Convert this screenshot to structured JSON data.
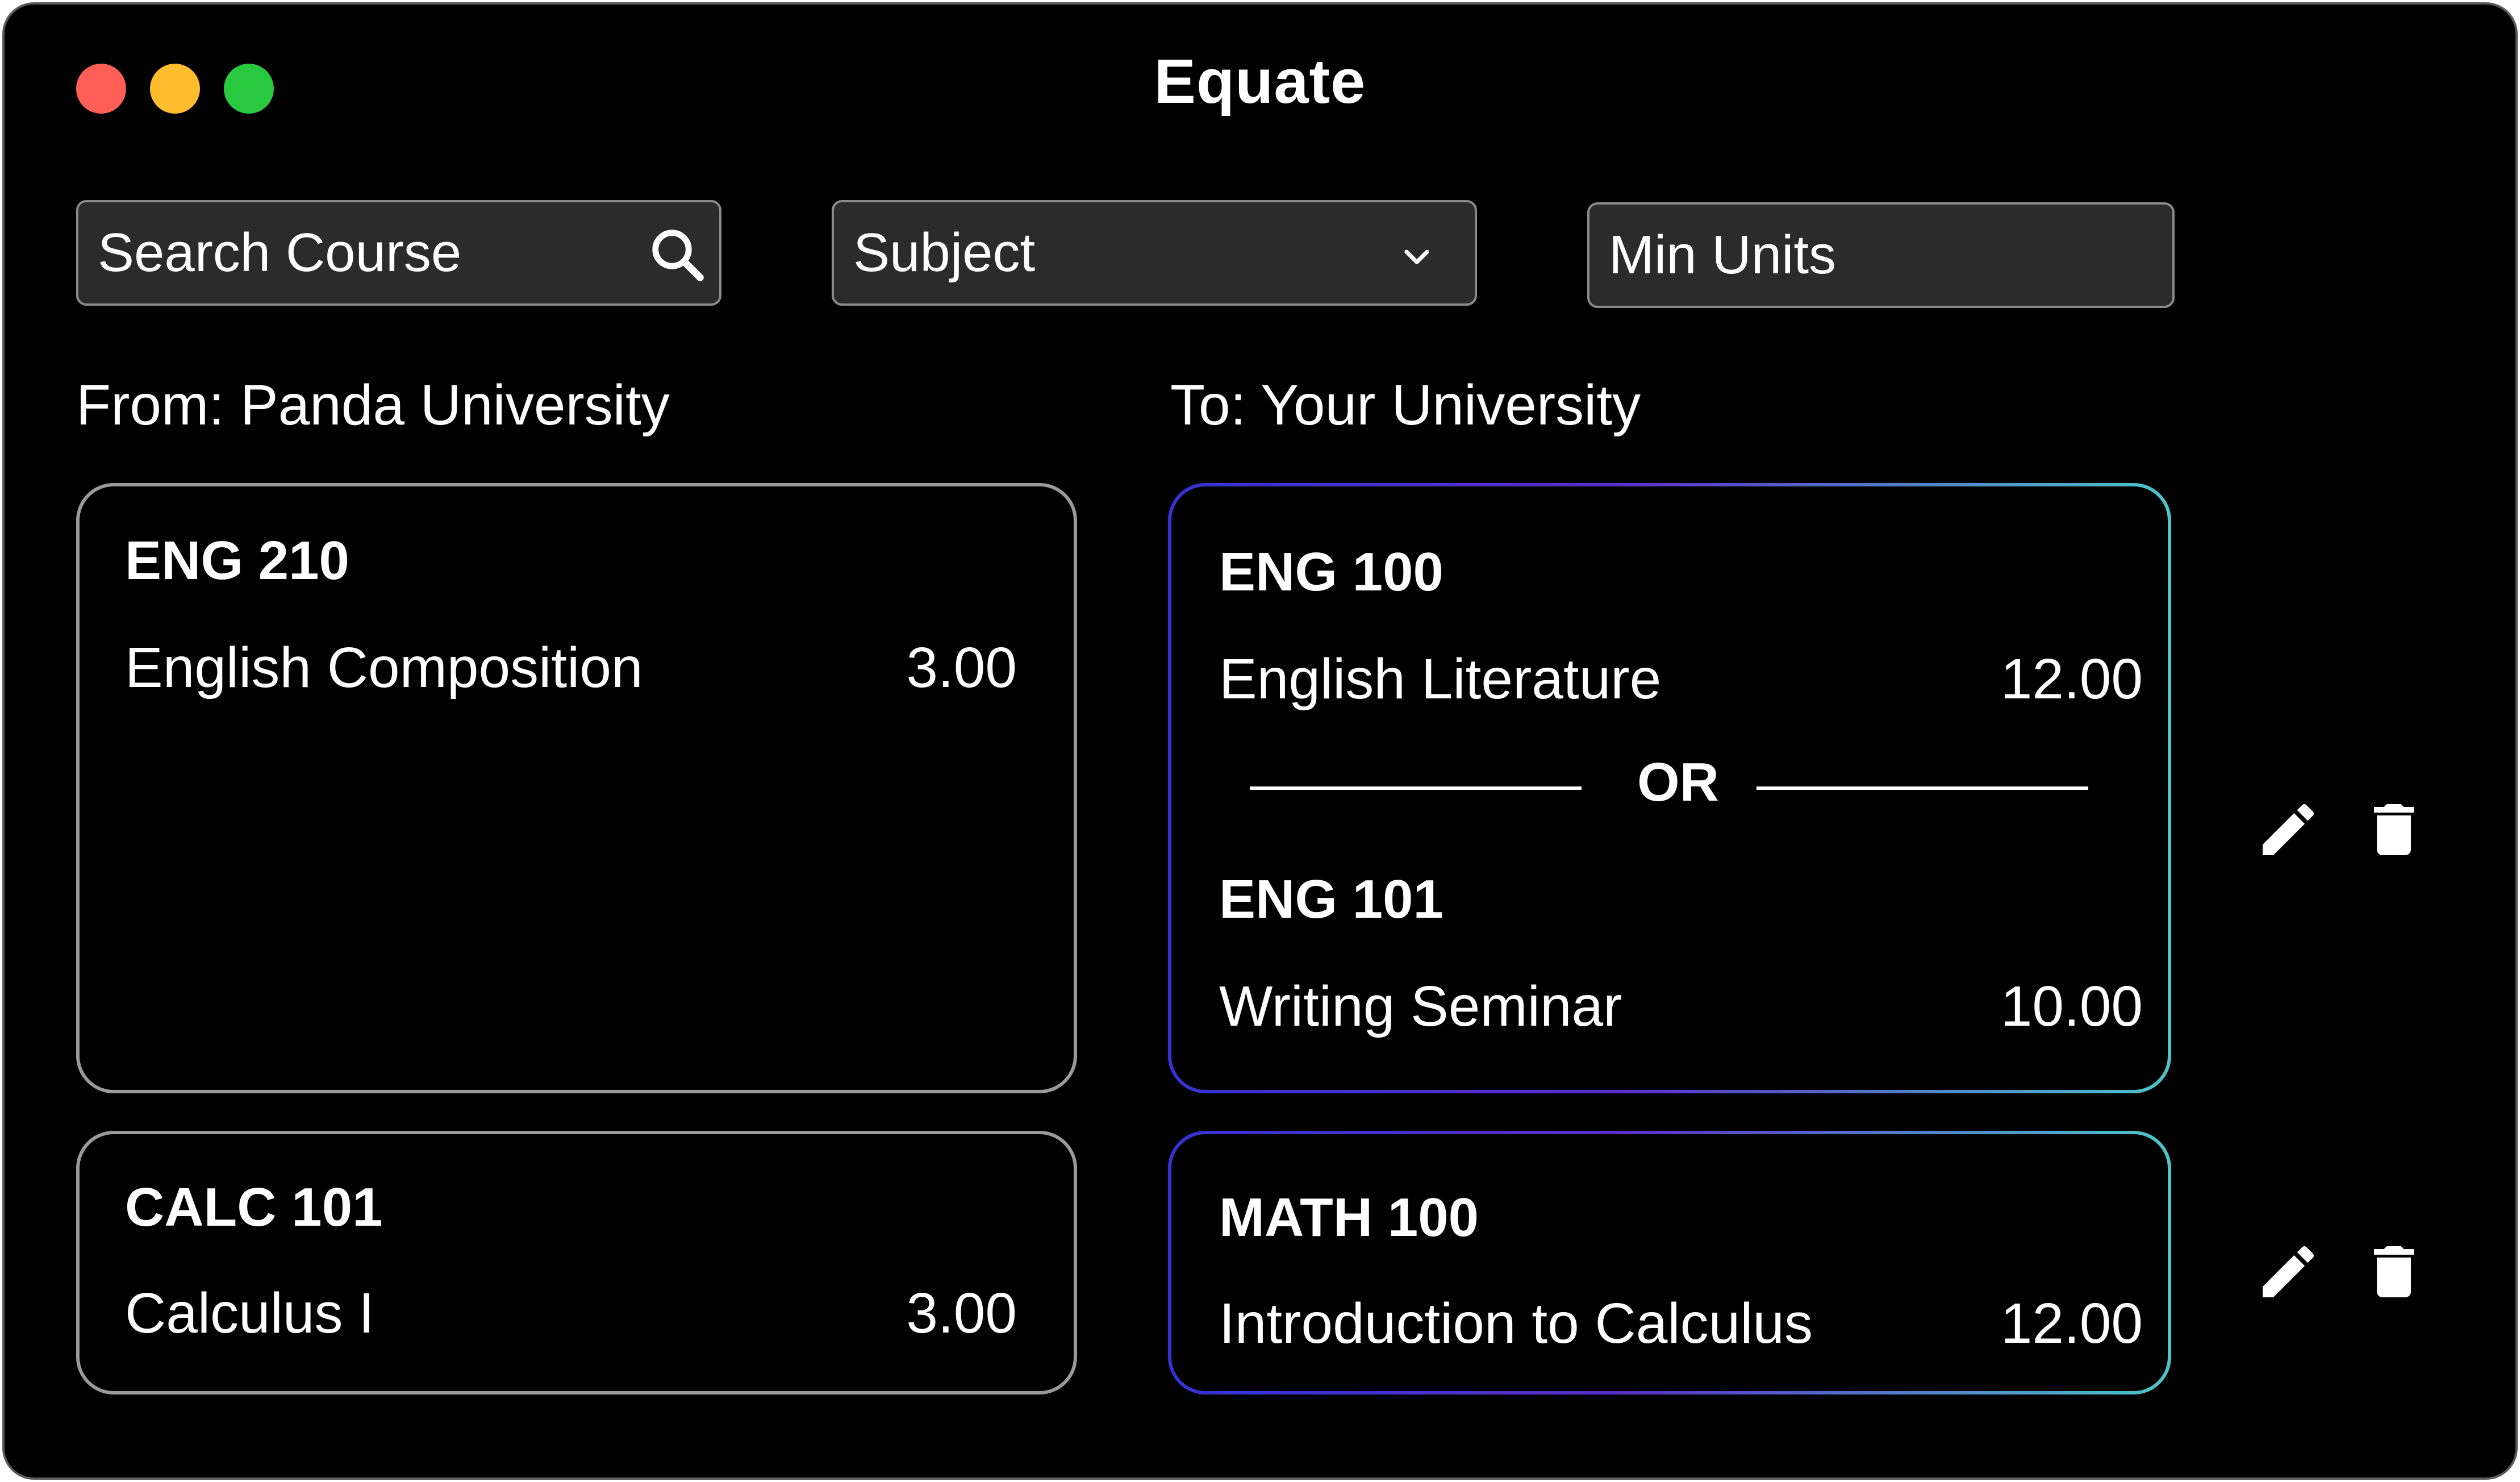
{
  "window": {
    "title": "Equate"
  },
  "filters": {
    "search_placeholder": "Search Course",
    "subject_label": "Subject",
    "min_units_placeholder": "Min Units"
  },
  "from": {
    "label": "From: Panda University",
    "courses": [
      {
        "code": "ENG 210",
        "name": "English Composition",
        "units": "3.00"
      },
      {
        "code": "CALC 101",
        "name": "Calculus I",
        "units": "3.00"
      }
    ]
  },
  "to": {
    "label": "To: Your University",
    "groups": [
      {
        "options": [
          {
            "code": "ENG 100",
            "name": "English Literature",
            "units": "12.00"
          },
          {
            "code": "ENG 101",
            "name": "Writing Seminar",
            "units": "10.00"
          }
        ],
        "separator": "OR"
      },
      {
        "options": [
          {
            "code": "MATH 100",
            "name": "Introduction to Calculus",
            "units": "12.00"
          }
        ]
      }
    ]
  },
  "icons": {
    "search": "search-icon",
    "dropdown": "chevron-down-icon",
    "edit": "pencil-icon",
    "delete": "trash-icon"
  },
  "colors": {
    "close": "#ff5f57",
    "minimize": "#febc2e",
    "maximize": "#28c840",
    "gradient_start": "#3433d6",
    "gradient_end": "#4bc6c9"
  }
}
